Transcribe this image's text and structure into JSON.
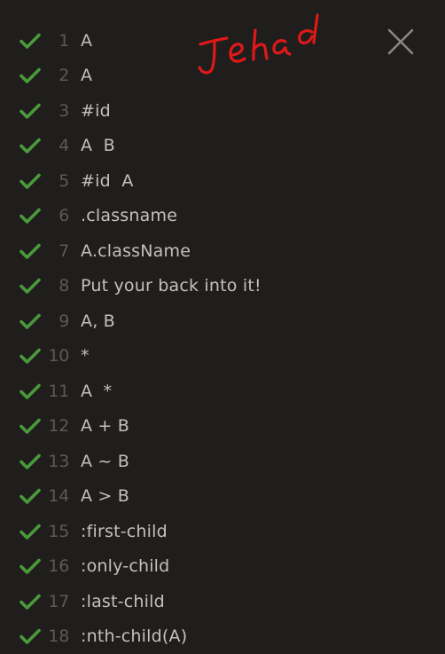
{
  "levels": [
    {
      "number": "1",
      "selector": "A"
    },
    {
      "number": "2",
      "selector": "A"
    },
    {
      "number": "3",
      "selector": "#id"
    },
    {
      "number": "4",
      "selector": "A  B"
    },
    {
      "number": "5",
      "selector": "#id  A"
    },
    {
      "number": "6",
      "selector": ".classname"
    },
    {
      "number": "7",
      "selector": "A.className"
    },
    {
      "number": "8",
      "selector": "Put your back into it!"
    },
    {
      "number": "9",
      "selector": "A, B"
    },
    {
      "number": "10",
      "selector": "*"
    },
    {
      "number": "11",
      "selector": "A  *"
    },
    {
      "number": "12",
      "selector": "A + B"
    },
    {
      "number": "13",
      "selector": "A ~ B"
    },
    {
      "number": "14",
      "selector": "A > B"
    },
    {
      "number": "15",
      "selector": ":first-child"
    },
    {
      "number": "16",
      "selector": ":only-child"
    },
    {
      "number": "17",
      "selector": ":last-child"
    },
    {
      "number": "18",
      "selector": ":nth-child(A)"
    }
  ],
  "handwriting": "Jehad",
  "icons": {
    "check": "check-icon",
    "close": "close-icon"
  },
  "colors": {
    "background": "#1f1e1c",
    "check": "#4a9a3c",
    "number": "#5d5a55",
    "text": "#c4c1bb",
    "handwriting": "#e01818",
    "close": "#8a8782"
  }
}
